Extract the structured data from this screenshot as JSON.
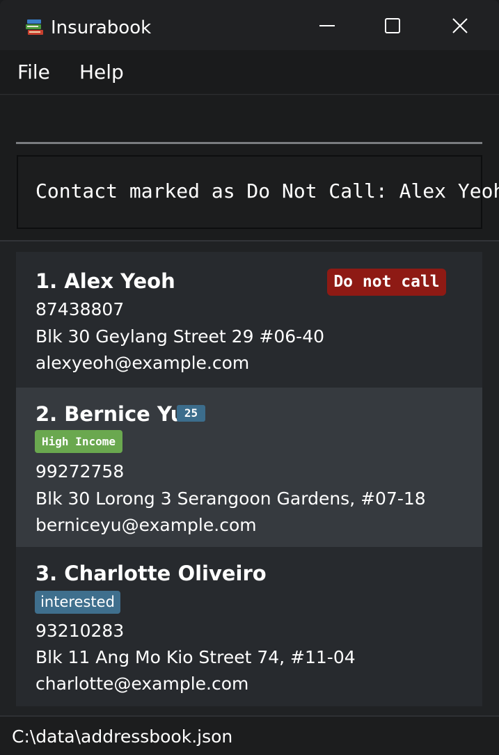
{
  "window": {
    "title": "Insurabook",
    "icon": "books-icon"
  },
  "menu": {
    "file_label": "File",
    "help_label": "Help"
  },
  "command": {
    "input_value": "",
    "result_text": "Contact marked as Do Not Call: Alex Yeoh"
  },
  "contacts": [
    {
      "name": "1. Alex Yeoh",
      "tag": "Do not call",
      "phone": "87438807",
      "address": "Blk 30 Geylang Street 29  #06-40",
      "email": "alexyeoh@example.com"
    },
    {
      "name": "2. Bernice Yu",
      "age": "25",
      "tag": "High Income",
      "phone": "99272758",
      "address": "Blk 30 Lorong 3 Serangoon Gardens, #07-18",
      "email": "berniceyu@example.com"
    },
    {
      "name": "3. Charlotte Oliveiro",
      "tag": "interested",
      "phone": "93210283",
      "address": "Blk 11 Ang Mo Kio Street 74, #11-04",
      "email": "charlotte@example.com"
    }
  ],
  "status": {
    "path": "C:\\data\\addressbook.json"
  },
  "colors": {
    "do_not_call": "#8e1a14",
    "age_badge": "#3c6d8c",
    "high_income": "#6aa84f",
    "interested": "#3f6f8d"
  }
}
